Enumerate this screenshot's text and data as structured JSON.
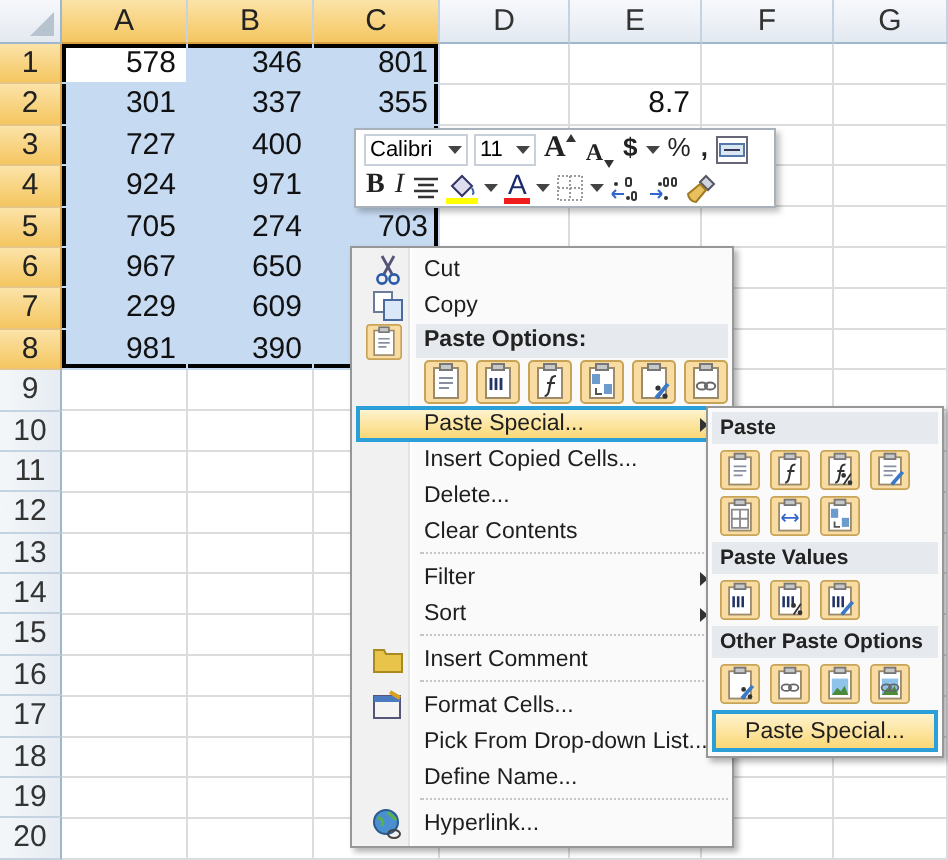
{
  "columns": [
    {
      "label": "A",
      "selected": true
    },
    {
      "label": "B",
      "selected": true
    },
    {
      "label": "C",
      "selected": true
    },
    {
      "label": "D",
      "selected": false
    },
    {
      "label": "E",
      "selected": false
    },
    {
      "label": "F",
      "selected": false
    },
    {
      "label": "G",
      "selected": false
    }
  ],
  "rows": [
    {
      "label": "1",
      "selected": true,
      "cells": [
        {
          "value": "578",
          "selected": true,
          "active": true
        },
        {
          "value": "346",
          "selected": true,
          "active": false
        },
        {
          "value": "801",
          "selected": true,
          "active": false
        }
      ]
    },
    {
      "label": "2",
      "selected": true,
      "cells": [
        {
          "value": "301",
          "selected": true,
          "active": false
        },
        {
          "value": "337",
          "selected": true,
          "active": false
        },
        {
          "value": "355",
          "selected": true,
          "active": false
        },
        null,
        {
          "value": "8.7",
          "selected": false,
          "active": false
        }
      ]
    },
    {
      "label": "3",
      "selected": true,
      "cells": [
        {
          "value": "727",
          "selected": true,
          "active": false
        },
        {
          "value": "400",
          "selected": true,
          "active": false
        },
        {
          "selected": true,
          "active": false
        }
      ]
    },
    {
      "label": "4",
      "selected": true,
      "cells": [
        {
          "value": "924",
          "selected": true,
          "active": false
        },
        {
          "value": "971",
          "selected": true,
          "active": false
        },
        {
          "selected": true,
          "active": false
        }
      ]
    },
    {
      "label": "5",
      "selected": true,
      "cells": [
        {
          "value": "705",
          "selected": true,
          "active": false
        },
        {
          "value": "274",
          "selected": true,
          "active": false
        },
        {
          "value": "703",
          "selected": true,
          "active": false
        }
      ]
    },
    {
      "label": "6",
      "selected": true,
      "cells": [
        {
          "value": "967",
          "selected": true,
          "active": false
        },
        {
          "value": "650",
          "selected": true,
          "active": false
        },
        {
          "selected": true,
          "active": false
        }
      ]
    },
    {
      "label": "7",
      "selected": true,
      "cells": [
        {
          "value": "229",
          "selected": true,
          "active": false
        },
        {
          "value": "609",
          "selected": true,
          "active": false
        },
        {
          "selected": true,
          "active": false
        }
      ]
    },
    {
      "label": "8",
      "selected": true,
      "cells": [
        {
          "value": "981",
          "selected": true,
          "active": false
        },
        {
          "value": "390",
          "selected": true,
          "active": false
        },
        {
          "selected": true,
          "active": false
        }
      ]
    },
    {
      "label": "9",
      "selected": false
    },
    {
      "label": "10",
      "selected": false
    },
    {
      "label": "11",
      "selected": false
    },
    {
      "label": "12",
      "selected": false
    },
    {
      "label": "13",
      "selected": false
    },
    {
      "label": "14",
      "selected": false
    },
    {
      "label": "15",
      "selected": false
    },
    {
      "label": "16",
      "selected": false
    },
    {
      "label": "17",
      "selected": false
    },
    {
      "label": "18",
      "selected": false
    },
    {
      "label": "19",
      "selected": false
    },
    {
      "label": "20",
      "selected": false
    }
  ],
  "mini_toolbar": {
    "font": "Calibri",
    "size": "11",
    "row_1": [
      {
        "kind": "grow_font",
        "label": "A"
      },
      {
        "kind": "shrink_font",
        "label": "A"
      },
      {
        "kind": "currency",
        "label": "$"
      },
      {
        "kind": "dropdown"
      },
      {
        "kind": "percent",
        "label": "%"
      },
      {
        "kind": "comma",
        "label": ","
      },
      {
        "kind": "merge"
      }
    ],
    "row_2": [
      {
        "kind": "bold",
        "label": "B"
      },
      {
        "kind": "italic",
        "label": "I"
      },
      {
        "kind": "align"
      },
      {
        "kind": "fill_color"
      },
      {
        "kind": "dropdown"
      },
      {
        "kind": "font_color",
        "label": "A"
      },
      {
        "kind": "dropdown"
      },
      {
        "kind": "borders"
      },
      {
        "kind": "dropdown"
      },
      {
        "kind": "increase_decimal"
      },
      {
        "kind": "decrease_decimal"
      },
      {
        "kind": "format_painter"
      }
    ]
  },
  "context_menu": {
    "items": [
      {
        "kind": "cut",
        "label": "Cut",
        "selected": false,
        "submenu": false
      },
      {
        "kind": "copy",
        "label": "Copy",
        "selected": false,
        "submenu": false
      },
      {
        "kind": "header",
        "label": "Paste Options:"
      },
      {
        "kind": "icons",
        "icons": [
          {
            "kind": "paste"
          },
          {
            "kind": "values"
          },
          {
            "kind": "formulas"
          },
          {
            "kind": "transpose"
          },
          {
            "kind": "formatting"
          },
          {
            "kind": "link"
          }
        ]
      },
      {
        "kind": "plain",
        "label": "Paste Special...",
        "selected": true,
        "submenu": true
      },
      {
        "kind": "plain",
        "label": "Insert Copied Cells...",
        "selected": false,
        "submenu": false
      },
      {
        "kind": "plain",
        "label": "Delete...",
        "selected": false,
        "submenu": false
      },
      {
        "kind": "plain",
        "label": "Clear Contents",
        "selected": false,
        "submenu": false
      },
      {
        "kind": "separator"
      },
      {
        "kind": "plain",
        "label": "Filter",
        "selected": false,
        "submenu": true
      },
      {
        "kind": "plain",
        "label": "Sort",
        "selected": false,
        "submenu": true
      },
      {
        "kind": "separator"
      },
      {
        "kind": "comment",
        "label": "Insert Comment",
        "selected": false,
        "submenu": false
      },
      {
        "kind": "separator"
      },
      {
        "kind": "format",
        "label": "Format Cells...",
        "selected": false,
        "submenu": false
      },
      {
        "kind": "plain",
        "label": "Pick From Drop-down List...",
        "selected": false,
        "submenu": false
      },
      {
        "kind": "plain",
        "label": "Define Name...",
        "selected": false,
        "submenu": false
      },
      {
        "kind": "separator"
      },
      {
        "kind": "link",
        "label": "Hyperlink...",
        "selected": false,
        "submenu": false
      }
    ]
  },
  "submenu": {
    "sections": [
      {
        "title": "Paste",
        "icons": [
          {
            "kind": "paste"
          },
          {
            "kind": "formulas"
          },
          {
            "kind": "formulas_format"
          },
          {
            "kind": "source_format"
          },
          {
            "kind": "no_borders"
          },
          {
            "kind": "widths"
          },
          {
            "kind": "transpose"
          }
        ]
      },
      {
        "title": "Paste Values",
        "icons": [
          {
            "kind": "values"
          },
          {
            "kind": "values_format"
          },
          {
            "kind": "values_source"
          }
        ]
      },
      {
        "title": "Other Paste Options",
        "icons": [
          {
            "kind": "formatting"
          },
          {
            "kind": "link"
          },
          {
            "kind": "picture"
          },
          {
            "kind": "linked_picture"
          }
        ]
      }
    ],
    "button": {
      "label": "Paste Special...",
      "selected": true
    }
  }
}
